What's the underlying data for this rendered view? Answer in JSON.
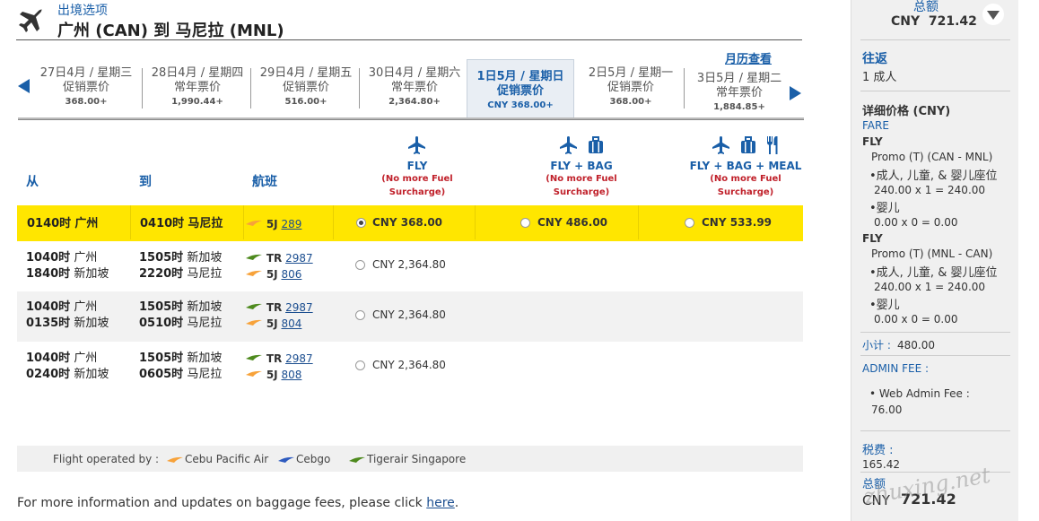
{
  "header": {
    "subtitle": "出境选项",
    "route": "广州 (CAN) 到 马尼拉 (MNL)",
    "calendar_link": "月历查看"
  },
  "dates": [
    {
      "d1": "27日4月 / 星期三",
      "d2": "促销票价",
      "price": "368.00+"
    },
    {
      "d1": "28日4月 / 星期四",
      "d2": "常年票价",
      "price": "1,990.44+"
    },
    {
      "d1": "29日4月 / 星期五",
      "d2": "促销票价",
      "price": "516.00+"
    },
    {
      "d1": "30日4月 / 星期六",
      "d2": "常年票价",
      "price": "2,364.80+"
    },
    {
      "d1": "1日5月 / 星期日",
      "d2": "促销票价",
      "price": "CNY 368.00+"
    },
    {
      "d1": "2日5月 / 星期一",
      "d2": "促销票价",
      "price": "368.00+"
    },
    {
      "d1": "3日5月 / 星期二",
      "d2": "常年票价",
      "price": "1,884.85+"
    }
  ],
  "columns": {
    "from": "从",
    "to": "到",
    "flight": "航班"
  },
  "fares": [
    {
      "name": "FLY",
      "note1": "(No more Fuel",
      "note2": "Surcharge)"
    },
    {
      "name": "FLY + BAG",
      "note1": "(No more Fuel",
      "note2": "Surcharge)"
    },
    {
      "name": "FLY + BAG + MEAL",
      "note1": "(No more Fuel",
      "note2": "Surcharge)"
    }
  ],
  "flights": [
    {
      "dep_time": "0140时",
      "dep_city": "广州",
      "arr_time": "0410时",
      "arr_city": "马尼拉",
      "seg1_code": "5J",
      "seg1_num": "289",
      "price_fly": "CNY 368.00",
      "price_bag": "CNY 486.00",
      "price_meal": "CNY 533.99"
    },
    {
      "dep_time1": "1040时",
      "dep_city1": "广州",
      "dep_time2": "1840时",
      "dep_city2": "新加坡",
      "arr_time1": "1505时",
      "arr_city1": "新加坡",
      "arr_time2": "2220时",
      "arr_city2": "马尼拉",
      "seg1_code": "TR",
      "seg1_num": "2987",
      "seg2_code": "5J",
      "seg2_num": "806",
      "price_fly": "CNY 2,364.80"
    },
    {
      "dep_time1": "1040时",
      "dep_city1": "广州",
      "dep_time2": "0135时",
      "dep_city2": "新加坡",
      "arr_time1": "1505时",
      "arr_city1": "新加坡",
      "arr_time2": "0510时",
      "arr_city2": "马尼拉",
      "seg1_code": "TR",
      "seg1_num": "2987",
      "seg2_code": "5J",
      "seg2_num": "804",
      "price_fly": "CNY 2,364.80"
    },
    {
      "dep_time1": "1040时",
      "dep_city1": "广州",
      "dep_time2": "0240时",
      "dep_city2": "新加坡",
      "arr_time1": "1505时",
      "arr_city1": "新加坡",
      "arr_time2": "0605时",
      "arr_city2": "马尼拉",
      "seg1_code": "TR",
      "seg1_num": "2987",
      "seg2_code": "5J",
      "seg2_num": "808",
      "price_fly": "CNY 2,364.80"
    }
  ],
  "legend": {
    "label": "Flight operated by :",
    "cebu": "Cebu Pacific Air",
    "cebgo": "Cebgo",
    "tiger": "Tigerair Singapore"
  },
  "more_info": {
    "text": "For more information and updates on baggage fees, please click ",
    "link": "here",
    "period": "."
  },
  "sidebar": {
    "total_label": "总额",
    "total_value": "CNY  721.42",
    "trip_label": "往返",
    "pax": "1 成人",
    "detail_label": "详细价格 (CNY)",
    "fare_label": "FARE",
    "seg1_label": "FLY",
    "seg1_route": "Promo (T) (CAN - MNL)",
    "seg1_adult": "•成人, 儿童, & 婴儿座位",
    "seg1_adult_calc": "240.00 x 1 = 240.00",
    "seg1_infant": "•婴儿",
    "seg1_infant_calc": "0.00 x 0 = 0.00",
    "seg2_label": "FLY",
    "seg2_route": "Promo (T) (MNL - CAN)",
    "seg2_adult": "•成人, 儿童, & 婴儿座位",
    "seg2_adult_calc": "240.00 x 1 = 240.00",
    "seg2_infant": "•婴儿",
    "seg2_infant_calc": "0.00 x 0 = 0.00",
    "subtotal_label": "小计 :",
    "subtotal_value": "480.00",
    "admin_label": "ADMIN FEE :",
    "web_admin_label": "• Web Admin Fee :",
    "web_admin_value": "76.00",
    "tax_label": "税费 :",
    "tax_value": "165.42",
    "total2_label": "总额",
    "total2_currency": "CNY",
    "total2_value": "721.42"
  },
  "watermark": "zhuxing.net",
  "colors": {
    "brand_blue": "#1a5fa8",
    "selected_row": "#ffe600",
    "note_red": "#c0202a"
  }
}
